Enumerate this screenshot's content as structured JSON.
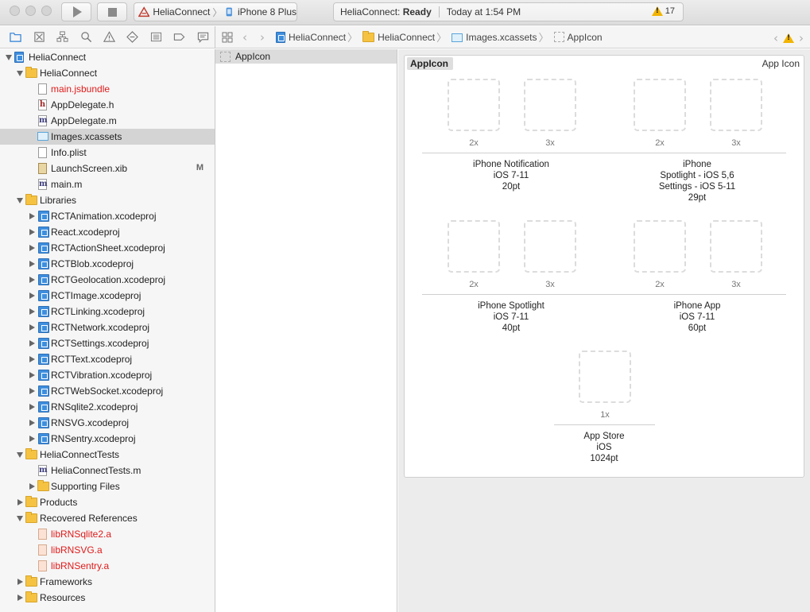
{
  "toolbar": {
    "scheme": "HeliaConnect",
    "device": "iPhone 8 Plus",
    "status_app": "HeliaConnect:",
    "status_state": "Ready",
    "status_time": "Today at 1:54 PM",
    "warning_count": "17"
  },
  "jumpbar": {
    "crumbs": [
      "HeliaConnect",
      "HeliaConnect",
      "Images.xcassets",
      "AppIcon"
    ]
  },
  "navigator": {
    "project": "HeliaConnect",
    "group_app": "HeliaConnect",
    "app_files": [
      {
        "name": "main.jsbundle",
        "kind": "blank",
        "missing": true
      },
      {
        "name": "AppDelegate.h",
        "kind": "h"
      },
      {
        "name": "AppDelegate.m",
        "kind": "m"
      },
      {
        "name": "Images.xcassets",
        "kind": "asset",
        "selected": true
      },
      {
        "name": "Info.plist",
        "kind": "blank"
      },
      {
        "name": "LaunchScreen.xib",
        "kind": "xib",
        "badge": "M"
      },
      {
        "name": "main.m",
        "kind": "m"
      }
    ],
    "group_libraries": "Libraries",
    "libraries": [
      "RCTAnimation.xcodeproj",
      "React.xcodeproj",
      "RCTActionSheet.xcodeproj",
      "RCTBlob.xcodeproj",
      "RCTGeolocation.xcodeproj",
      "RCTImage.xcodeproj",
      "RCTLinking.xcodeproj",
      "RCTNetwork.xcodeproj",
      "RCTSettings.xcodeproj",
      "RCTText.xcodeproj",
      "RCTVibration.xcodeproj",
      "RCTWebSocket.xcodeproj",
      "RNSqlite2.xcodeproj",
      "RNSVG.xcodeproj",
      "RNSentry.xcodeproj"
    ],
    "group_tests": "HeliaConnectTests",
    "tests_file": "HeliaConnectTests.m",
    "tests_support": "Supporting Files",
    "group_products": "Products",
    "group_recovered": "Recovered References",
    "recovered": [
      "libRNSqlite2.a",
      "libRNSVG.a",
      "libRNSentry.a"
    ],
    "group_frameworks": "Frameworks",
    "group_resources": "Resources"
  },
  "asset_list": {
    "items": [
      "AppIcon"
    ]
  },
  "editor": {
    "set_name": "AppIcon",
    "set_type": "App Icon",
    "groups": [
      {
        "scales": [
          "2x",
          "3x"
        ],
        "lines": [
          "iPhone Notification",
          "iOS 7-11",
          "20pt"
        ]
      },
      {
        "scales": [
          "2x",
          "3x"
        ],
        "lines": [
          "iPhone",
          "Spotlight - iOS 5,6",
          "Settings - iOS 5-11",
          "29pt"
        ]
      },
      {
        "scales": [
          "2x",
          "3x"
        ],
        "lines": [
          "iPhone Spotlight",
          "iOS 7-11",
          "40pt"
        ]
      },
      {
        "scales": [
          "2x",
          "3x"
        ],
        "lines": [
          "iPhone App",
          "iOS 7-11",
          "60pt"
        ]
      },
      {
        "scales": [
          "1x"
        ],
        "lines": [
          "App Store",
          "iOS",
          "1024pt"
        ]
      }
    ]
  },
  "colors": {
    "missing_file": "#e01b1b",
    "warning": "#f2b400",
    "selection": "#d4d4d4"
  }
}
